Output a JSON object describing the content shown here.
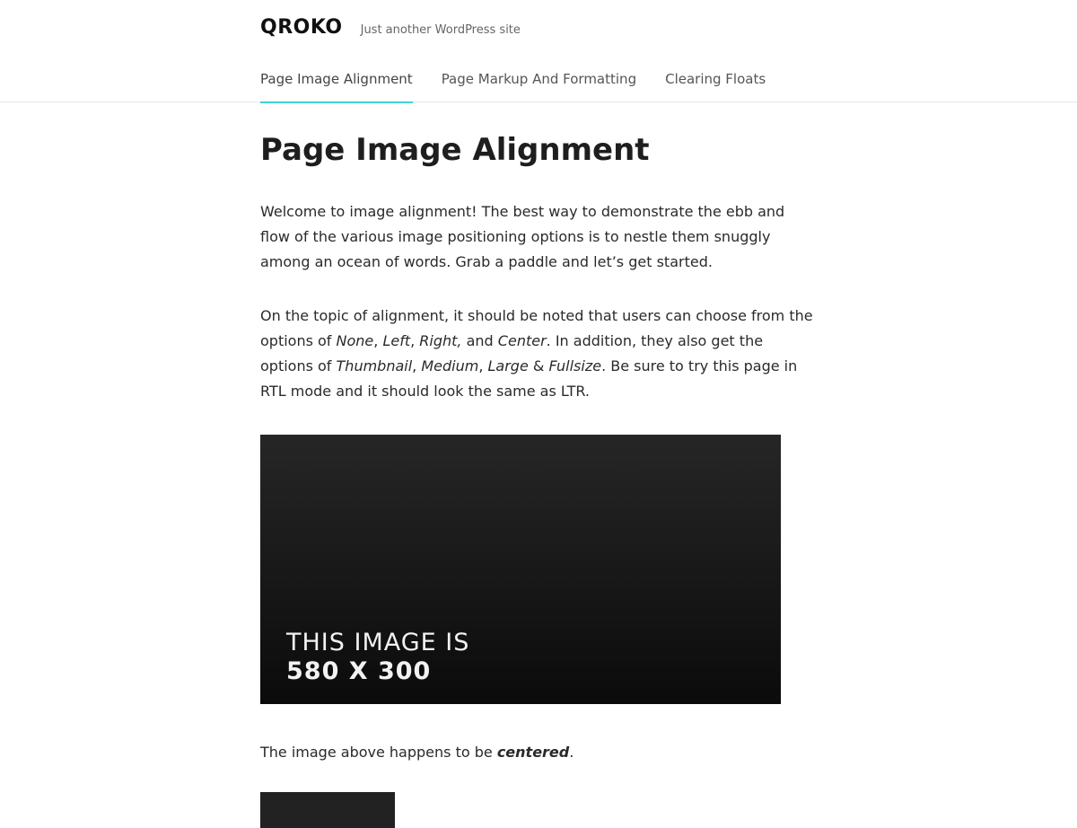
{
  "site": {
    "title": "QROKO",
    "description": "Just another WordPress site"
  },
  "nav": {
    "items": [
      {
        "label": "Page Image Alignment",
        "active": true
      },
      {
        "label": "Page Markup And Formatting",
        "active": false
      },
      {
        "label": "Clearing Floats",
        "active": false
      }
    ]
  },
  "colors": {
    "accent": "#3fd4d0"
  },
  "page": {
    "title": "Page Image Alignment",
    "para1": "Welcome to image alignment! The best way to demonstrate the ebb and flow of the various image positioning options is to nestle them snuggly among an ocean of words. Grab a paddle and let’s get started.",
    "para2": {
      "t1": "On the topic of alignment, it should be noted that users can choose from the options of ",
      "none": "None",
      "c1": ", ",
      "left": "Left",
      "c2": ", ",
      "right": "Right,",
      "and1": " and ",
      "center": "Center",
      "t2": ". In addition, they also get the options of ",
      "thumbnail": "Thumbnail",
      "c3": ", ",
      "medium": "Medium",
      "c4": ", ",
      "large": "Large",
      "amp": " & ",
      "fullsize": "Fullsize",
      "t3": ". Be sure to try this page in RTL mode and it should look the same as LTR."
    },
    "image": {
      "line1": "THIS IMAGE IS",
      "line2": "580 X 300"
    },
    "para3": {
      "t1": "The image above happens to be ",
      "centered": "centered",
      "t2": "."
    }
  }
}
